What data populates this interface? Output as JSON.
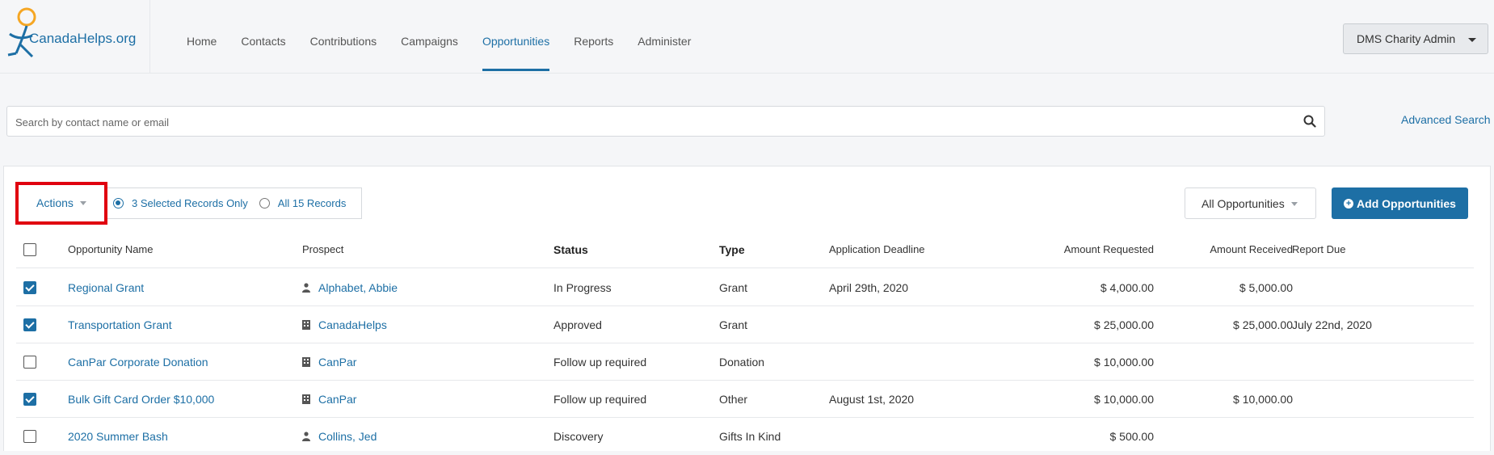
{
  "brand": {
    "name_main": "CanadaHelps",
    "name_suffix": ".org"
  },
  "nav": [
    {
      "label": "Home",
      "active": false
    },
    {
      "label": "Contacts",
      "active": false
    },
    {
      "label": "Contributions",
      "active": false
    },
    {
      "label": "Campaigns",
      "active": false
    },
    {
      "label": "Opportunities",
      "active": true
    },
    {
      "label": "Reports",
      "active": false
    },
    {
      "label": "Administer",
      "active": false
    }
  ],
  "user_menu": {
    "label": "DMS Charity Admin"
  },
  "search": {
    "placeholder": "Search by contact name or email",
    "value": "",
    "advanced_label": "Advanced Search"
  },
  "toolbar": {
    "actions_label": "Actions",
    "selected_option": "3 Selected Records Only",
    "all_option": "All 15 Records",
    "filter_label": "All Opportunities",
    "add_label": "Add Opportunities"
  },
  "table": {
    "headers": {
      "name": "Opportunity Name",
      "prospect": "Prospect",
      "status": "Status",
      "type": "Type",
      "deadline": "Application Deadline",
      "requested": "Amount Requested",
      "received": "Amount Received",
      "report_due": "Report Due"
    },
    "rows": [
      {
        "checked": true,
        "name": "Regional Grant",
        "prospect": "Alphabet, Abbie",
        "prospect_icon": "person-icon",
        "status": "In Progress",
        "type": "Grant",
        "deadline": "April 29th, 2020",
        "requested": "$ 4,000.00",
        "received": "$ 5,000.00",
        "report_due": ""
      },
      {
        "checked": true,
        "name": "Transportation Grant",
        "prospect": "CanadaHelps",
        "prospect_icon": "building-icon",
        "status": "Approved",
        "type": "Grant",
        "deadline": "",
        "requested": "$ 25,000.00",
        "received": "$ 25,000.00",
        "report_due": "July 22nd, 2020"
      },
      {
        "checked": false,
        "name": "CanPar Corporate Donation",
        "prospect": "CanPar",
        "prospect_icon": "building-icon",
        "status": "Follow up required",
        "type": "Donation",
        "deadline": "",
        "requested": "$ 10,000.00",
        "received": "",
        "report_due": ""
      },
      {
        "checked": true,
        "name": "Bulk Gift Card Order $10,000",
        "prospect": "CanPar",
        "prospect_icon": "building-icon",
        "status": "Follow up required",
        "type": "Other",
        "deadline": "August 1st, 2020",
        "requested": "$ 10,000.00",
        "received": "$ 10,000.00",
        "report_due": ""
      },
      {
        "checked": false,
        "name": "2020 Summer Bash",
        "prospect": "Collins, Jed",
        "prospect_icon": "person-icon",
        "status": "Discovery",
        "type": "Gifts In Kind",
        "deadline": "",
        "requested": "$ 500.00",
        "received": "",
        "report_due": ""
      }
    ]
  },
  "colors": {
    "accent": "#1d6fa5",
    "highlight": "#e0000f"
  }
}
